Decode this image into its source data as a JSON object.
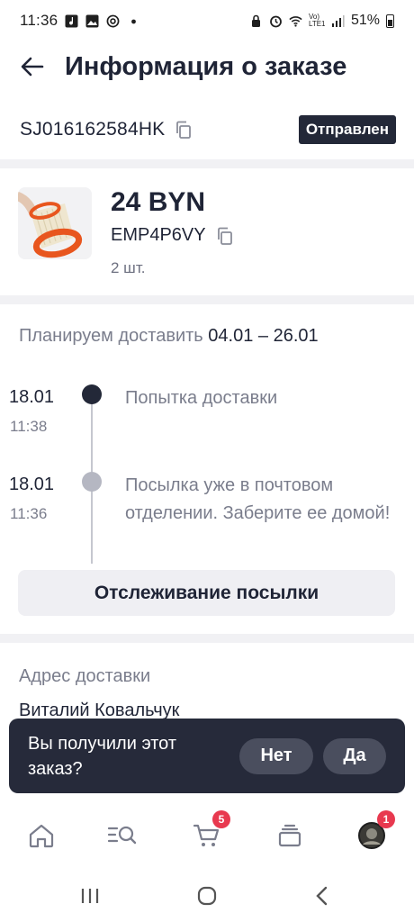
{
  "status_bar": {
    "time": "11:36",
    "battery": "51%",
    "network": "Vo) LTE1"
  },
  "header": {
    "title": "Информация о заказе",
    "back_icon": "arrow-left-icon"
  },
  "order": {
    "id": "SJ016162584HK",
    "status": "Отправлен"
  },
  "product": {
    "price": "24 BYN",
    "sku": "EMP4P6VY",
    "quantity": "2 шт."
  },
  "delivery": {
    "plan_label": "Планируем доставить",
    "plan_dates": "04.01 – 26.01",
    "events": [
      {
        "date": "18.01",
        "time": "11:38",
        "text": "Попытка доставки"
      },
      {
        "date": "18.01",
        "time": "11:36",
        "text": "Посылка уже в почтовом отделении. Заберите ее домой!"
      }
    ],
    "track_button": "Отслеживание посылки"
  },
  "address": {
    "label": "Адрес доставки",
    "name": "Виталий Ковальчук"
  },
  "snackbar": {
    "question": "Вы получили этот заказ?",
    "no_label": "Нет",
    "yes_label": "Да"
  },
  "bottom_nav": {
    "cart_badge": "5",
    "profile_badge": "1"
  },
  "colors": {
    "accent_dark": "#232838",
    "badge_red": "#e8394f",
    "muted_text": "#7a7d8c"
  }
}
